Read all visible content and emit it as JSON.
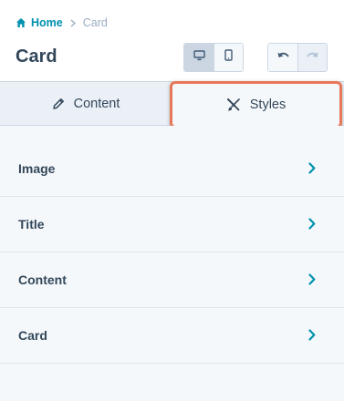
{
  "breadcrumb": {
    "home": "Home",
    "separator": "›",
    "current": "Card"
  },
  "page_title": "Card",
  "device_toggle": {
    "selected": "desktop",
    "options": [
      "desktop",
      "mobile"
    ]
  },
  "history": {
    "undo_enabled": true,
    "redo_enabled": false
  },
  "tabs": [
    {
      "label": "Content",
      "icon": "pencil-icon"
    },
    {
      "label": "Styles",
      "icon": "brush-icon",
      "active": true,
      "highlighted": true
    }
  ],
  "sections": [
    {
      "label": "Image"
    },
    {
      "label": "Title"
    },
    {
      "label": "Content"
    },
    {
      "label": "Card"
    }
  ],
  "colors": {
    "accent": "#0091ae",
    "highlight": "#e8775a",
    "text": "#33475b",
    "muted": "#99acc2"
  }
}
